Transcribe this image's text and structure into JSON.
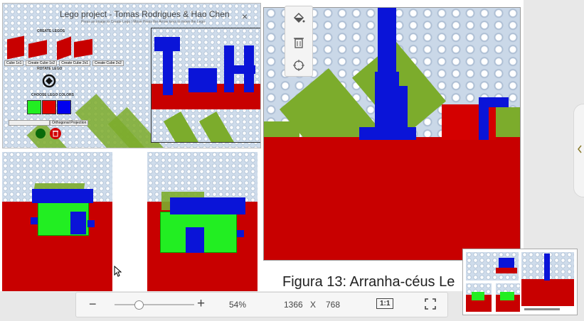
{
  "window": {
    "background": "#e8e8e8"
  },
  "document": {
    "caption": "Figura 13: Arranha-céus Le"
  },
  "app_screenshot": {
    "title": "Lego project - Tomas Rodrigues & Hao Chen",
    "subtitle": "Press an image to Create Lego / Move Press the Arrow keys to move the Lego",
    "create_label": "CREATE LEGOS",
    "block_buttons": [
      "Cube 1x1",
      "Create Cube 1x2",
      "Create Cube 2x1",
      "Create Cube 2x2"
    ],
    "rotate_label": "ROTATE LEGO",
    "colors_label": "CHOOSE LEGO COLORS",
    "color_swatches": [
      "#22ee22",
      "#e00000",
      "#0000ee"
    ],
    "projection_select": "Orthogonal Projection",
    "close_symbol": "×"
  },
  "toolbar": {
    "zoom_out": "−",
    "zoom_in": "+",
    "zoom_level": "54%",
    "zoom_fraction": 0.3,
    "width": "1366",
    "times": "X",
    "height": "768",
    "actual_size": "1:1"
  },
  "tool_panel": {
    "icons": [
      "paint-bucket-icon",
      "trash-icon",
      "crosshair-icon"
    ]
  },
  "colors": {
    "lego_red": "#c80000",
    "lego_blue": "#0a14d8",
    "lego_green": "#22ee22",
    "baseplate_green": "#7cac2c"
  }
}
